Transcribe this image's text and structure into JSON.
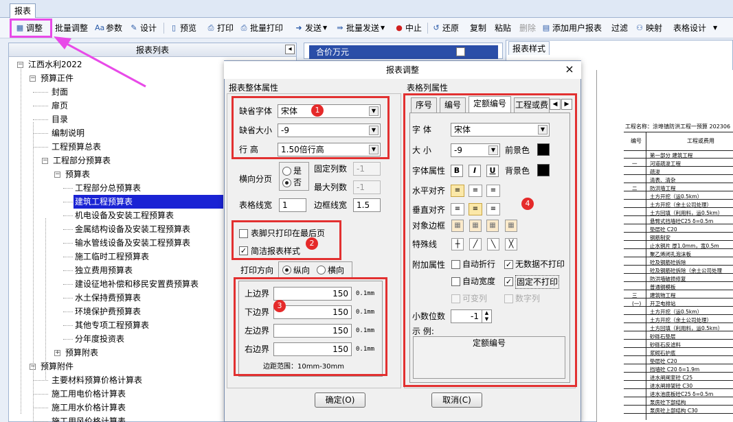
{
  "top_tab": "报表",
  "toolbar": {
    "adjust": "调整",
    "batch_adjust": "批量调整",
    "params": "参数",
    "design": "设计",
    "preview": "预览",
    "print": "打印",
    "batch_print": "批量打印",
    "send": "发送",
    "batch_send": "批量发送",
    "abort": "中止",
    "restore": "还原",
    "copy": "复制",
    "paste": "粘贴",
    "delete": "删除",
    "add_user_report": "添加用户报表",
    "filter": "过滤",
    "map": "映射",
    "table_design": "表格设计"
  },
  "left_panel": {
    "title": "报表列表",
    "tree": [
      {
        "label": "江西水利2022",
        "level": 0,
        "expander": "-"
      },
      {
        "label": "预算正件",
        "level": 1,
        "expander": "-"
      },
      {
        "label": "封面",
        "level": 2
      },
      {
        "label": "扉页",
        "level": 2
      },
      {
        "label": "目录",
        "level": 2
      },
      {
        "label": "编制说明",
        "level": 2
      },
      {
        "label": "工程预算总表",
        "level": 2
      },
      {
        "label": "工程部分预算表",
        "level": 2,
        "expander": "-"
      },
      {
        "label": "预算表",
        "level": 3,
        "expander": "-"
      },
      {
        "label": "工程部分总预算表",
        "level": 4
      },
      {
        "label": "建筑工程预算表",
        "level": 4,
        "selected": true
      },
      {
        "label": "机电设备及安装工程预算表",
        "level": 4
      },
      {
        "label": "金属结构设备及安装工程预算表",
        "level": 4
      },
      {
        "label": "输水管线设备及安装工程预算表",
        "level": 4
      },
      {
        "label": "施工临时工程预算表",
        "level": 4
      },
      {
        "label": "独立费用预算表",
        "level": 4
      },
      {
        "label": "建设征地补偿和移民安置费预算表",
        "level": 4
      },
      {
        "label": "水土保持费预算表",
        "level": 4
      },
      {
        "label": "环境保护费预算表",
        "level": 4
      },
      {
        "label": "其他专项工程预算表",
        "level": 4
      },
      {
        "label": "分年度投资表",
        "level": 4
      },
      {
        "label": "预算附表",
        "level": 3,
        "expander": "+"
      },
      {
        "label": "预算附件",
        "level": 1,
        "expander": "-"
      },
      {
        "label": "主要材料预算价格计算表",
        "level": 2
      },
      {
        "label": "施工用电价格计算表",
        "level": 2
      },
      {
        "label": "施工用水价格计算表",
        "level": 2
      },
      {
        "label": "施工用风价格计算表",
        "level": 2
      }
    ]
  },
  "middle_panel": {
    "header": "合价万元"
  },
  "right_panel": {
    "tab": "报表样式",
    "preview": {
      "title": "工程名称：涂埠镇防洪工程一预算 202306",
      "col_no": "编号",
      "col_name": "工程或费用",
      "rows": [
        {
          "no": "",
          "name": "第一部分  建筑工程"
        },
        {
          "no": "一",
          "name": "河道疏浚工程"
        },
        {
          "no": "",
          "name": "疏浚"
        },
        {
          "no": "",
          "name": "清表、清杂"
        },
        {
          "no": "二",
          "name": "防洪墙工程"
        },
        {
          "no": "",
          "name": "土方开挖（运0.5km）"
        },
        {
          "no": "",
          "name": "土方开挖（余土公司处理）"
        },
        {
          "no": "",
          "name": "土方回填（利用料，运0.5km）"
        },
        {
          "no": "",
          "name": "悬臂式挡墙砼C25  δ=0.5m"
        },
        {
          "no": "",
          "name": "垫层砼  C20"
        },
        {
          "no": "",
          "name": "钢筋制安"
        },
        {
          "no": "",
          "name": "止水铜片  厚1.0mm，宽0.5m"
        },
        {
          "no": "",
          "name": "聚乙烯闭孔泡沫板"
        },
        {
          "no": "",
          "name": "砼及钢筋砼拆除"
        },
        {
          "no": "",
          "name": "砼及钢筋砼拆除（余土公司处理"
        },
        {
          "no": "",
          "name": "防洪墙破损修复"
        },
        {
          "no": "",
          "name": "普通钢模板"
        },
        {
          "no": "三",
          "name": "建筑物工程"
        },
        {
          "no": "(一)",
          "name": "开卫电排站"
        },
        {
          "no": "",
          "name": "土方开挖（运0.5km）"
        },
        {
          "no": "",
          "name": "土方开挖（余土公司处理）"
        },
        {
          "no": "",
          "name": "土方回填（利用料，运0.5km）"
        },
        {
          "no": "",
          "name": "砂砾石垫层"
        },
        {
          "no": "",
          "name": "砂砾石反滤料"
        },
        {
          "no": "",
          "name": "浆砌石护底"
        },
        {
          "no": "",
          "name": "垫层砼  C20"
        },
        {
          "no": "",
          "name": "挡墙砼  C20  δ=1.9m"
        },
        {
          "no": "",
          "name": "进水闸闸室砼  C25"
        },
        {
          "no": "",
          "name": "进水闸排架砼  C30"
        },
        {
          "no": "",
          "name": "进水池底板砼C25  δ=0.5m"
        },
        {
          "no": "",
          "name": "泵房砼下部结构"
        },
        {
          "no": "",
          "name": "泵房砼上部结构  C30"
        }
      ]
    }
  },
  "dialog": {
    "title": "报表调整",
    "close": "×",
    "overall_group": "报表整体属性",
    "default_font_label": "缺省字体",
    "default_font_value": "宋体",
    "default_size_label": "缺省大小",
    "default_size_value": "-9",
    "line_height_label": "行    高",
    "line_height_value": "1.50倍行高",
    "hsplit_label": "横向分页",
    "yes": "是",
    "no": "否",
    "fixed_cols_label": "固定列数",
    "fixed_cols_value": "-1",
    "max_cols_label": "最大列数",
    "max_cols_value": "-1",
    "table_line_label": "表格线宽",
    "table_line_value": "1",
    "border_line_label": "边框线宽",
    "border_line_value": "1.5",
    "footer_last_label": "表脚只打印在最后页",
    "simple_style_label": "简洁报表样式",
    "print_dir_label": "打印方向",
    "portrait": "纵向",
    "landscape": "横向",
    "top_margin_label": "上边界",
    "top_margin_value": "150",
    "bottom_margin_label": "下边界",
    "bottom_margin_value": "150",
    "left_margin_label": "左边界",
    "left_margin_value": "150",
    "right_margin_label": "右边界",
    "right_margin_value": "150",
    "unit": "0.1mm",
    "margin_range": "边距范围：10mm-30mm",
    "col_group": "表格列属性",
    "tabs": [
      "序号",
      "编号",
      "定额编号",
      "工程或费"
    ],
    "font_label": "字    体",
    "font_value": "宋体",
    "size_label": "大    小",
    "size_value": "-9",
    "fg_label": "前景色",
    "font_attr_label": "字体属性",
    "bold": "B",
    "italic": "I",
    "underline": "U",
    "bg_label": "背景色",
    "halign_label": "水平对齐",
    "valign_label": "垂直对齐",
    "obj_border_label": "对象边框",
    "special_line_label": "特殊线",
    "extra_attr_label": "附加属性",
    "auto_wrap": "自动折行",
    "no_data_no_print": "无数据不打印",
    "auto_width": "自动宽度",
    "fixed_no_print": "固定不打印",
    "mutable_col": "可变列",
    "number_col": "数字列",
    "decimals_label": "小数位数",
    "decimals_value": "-1",
    "example_label": "示    例:",
    "example_text": "定额编号",
    "ok": "确定(O)",
    "cancel": "取消(C)"
  },
  "annotations": [
    "1",
    "2",
    "3",
    "4"
  ],
  "colors": {
    "selection": "#1a23d4",
    "highlight_red": "#e23030",
    "highlight_magenta": "#e84ae8"
  }
}
